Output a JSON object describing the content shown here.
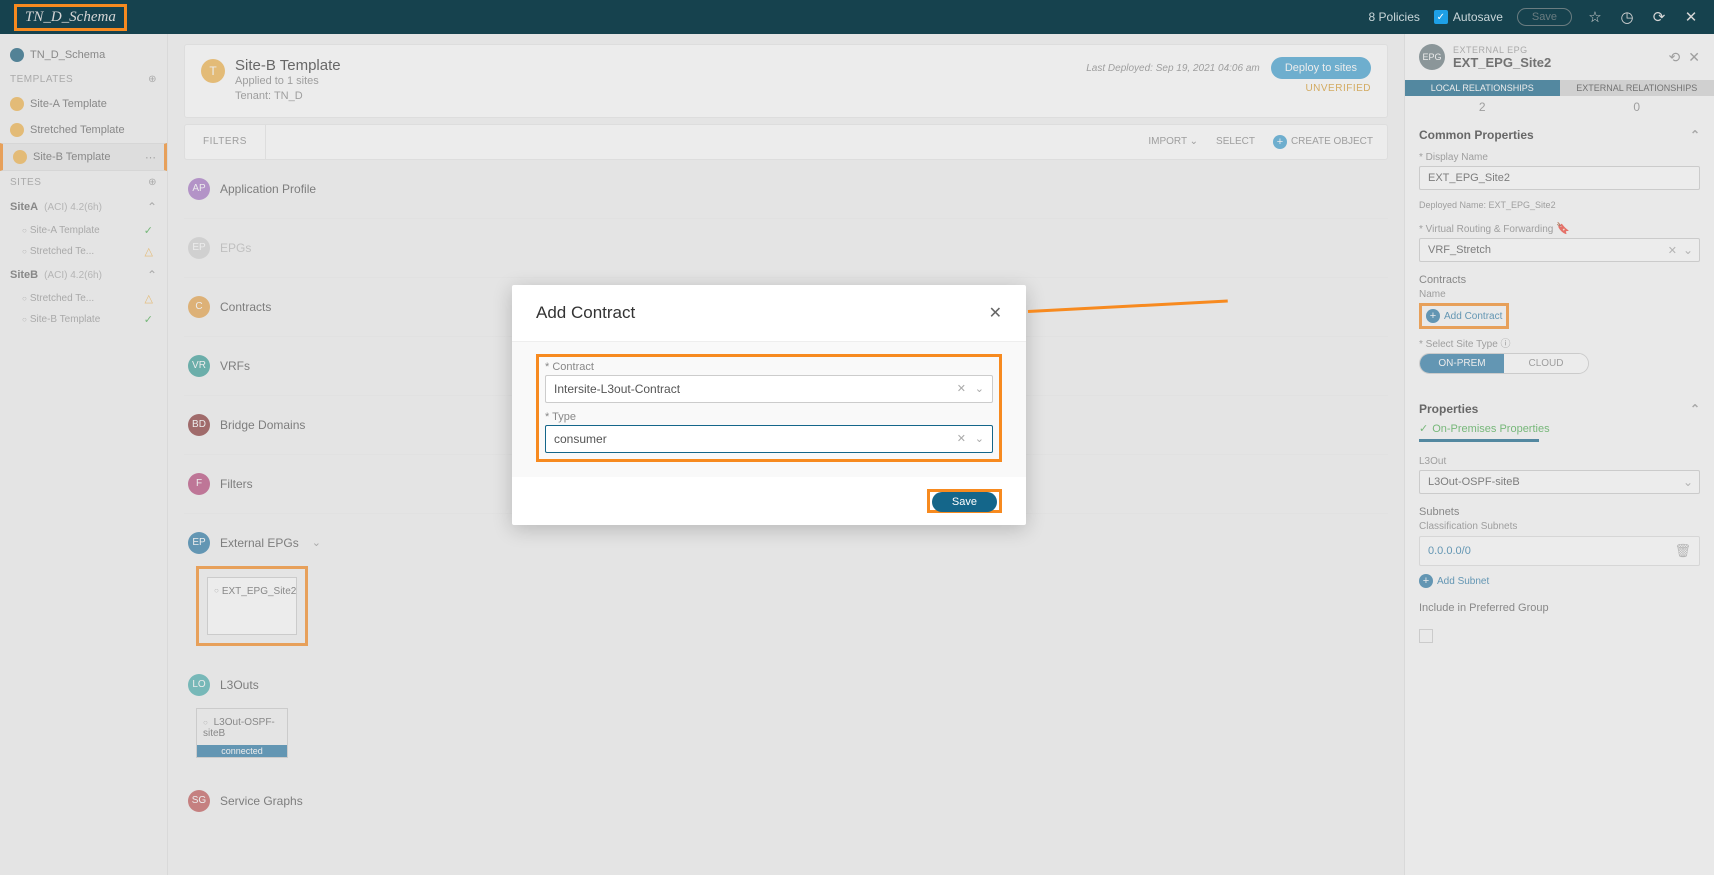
{
  "topbar": {
    "title": "TN_D_Schema",
    "policies": "8 Policies",
    "autosave": "Autosave",
    "save": "Save"
  },
  "sidebar": {
    "schema": "TN_D_Schema",
    "templates_h": "TEMPLATES",
    "sites_h": "SITES",
    "templates": [
      {
        "label": "Site-A Template"
      },
      {
        "label": "Stretched Template"
      },
      {
        "label": "Site-B Template"
      }
    ],
    "siteA": {
      "name": "SiteA",
      "meta": "(ACI) 4.2(6h)",
      "items": [
        {
          "label": "Site-A Template",
          "status": "ok"
        },
        {
          "label": "Stretched Te...",
          "status": "warn"
        }
      ]
    },
    "siteB": {
      "name": "SiteB",
      "meta": "(ACI) 4.2(6h)",
      "items": [
        {
          "label": "Stretched Te...",
          "status": "warn"
        },
        {
          "label": "Site-B Template",
          "status": "ok"
        }
      ]
    }
  },
  "template_header": {
    "badge": "T",
    "title": "Site-B Template",
    "applied": "Applied to 1 sites",
    "tenant": "Tenant: TN_D",
    "last_deployed": "Last Deployed: Sep 19, 2021 04:06 am",
    "deploy": "Deploy to sites",
    "status": "UNVERIFIED"
  },
  "filter_bar": {
    "filters": "FILTERS",
    "import": "IMPORT",
    "select": "SELECT",
    "create": "CREATE OBJECT"
  },
  "sections": {
    "app": "Application Profile",
    "epgs": "EPGs",
    "contracts": "Contracts",
    "vrfs": "VRFs",
    "bds": "Bridge Domains",
    "filters": "Filters",
    "extepgs": "External EPGs",
    "l3outs": "L3Outs",
    "sg": "Service Graphs"
  },
  "ext_epg_card": {
    "name": "EXT_EPG_Site2"
  },
  "l3out_card": {
    "name": "L3Out-OSPF-siteB",
    "status": "connected"
  },
  "rpanel": {
    "badge": "EPG",
    "sup": "EXTERNAL EPG",
    "title": "EXT_EPG_Site2",
    "local_tab": "LOCAL RELATIONSHIPS",
    "ext_tab": "EXTERNAL RELATIONSHIPS",
    "local_count": "2",
    "ext_count": "0",
    "common_h": "Common Properties",
    "dn_label": "* Display Name",
    "dn_value": "EXT_EPG_Site2",
    "deployed": "Deployed Name: EXT_EPG_Site2",
    "vrf_label": "* Virtual Routing & Forwarding",
    "vrf_value": "VRF_Stretch",
    "contracts_h": "Contracts",
    "name_h": "Name",
    "add_contract": "Add Contract",
    "select_site": "* Select Site Type",
    "onprem": "ON-PREM",
    "cloud": "CLOUD",
    "properties_h": "Properties",
    "onprem_props": "On-Premises Properties",
    "l3out_label": "L3Out",
    "l3out_value": "L3Out-OSPF-siteB",
    "subnets_label": "Subnets",
    "class_subnets": "Classification Subnets",
    "subnet0": "0.0.0.0/0",
    "add_subnet": "Add Subnet",
    "include_pg": "Include in Preferred Group"
  },
  "modal": {
    "title": "Add Contract",
    "contract_label": "* Contract",
    "contract_value": "Intersite-L3out-Contract",
    "type_label": "* Type",
    "type_value": "consumer",
    "save": "Save"
  }
}
